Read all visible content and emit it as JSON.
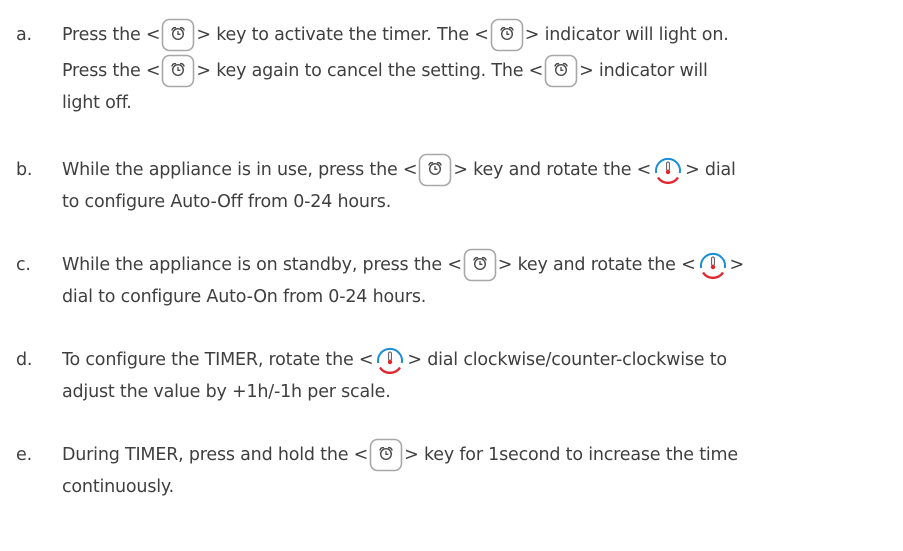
{
  "items": [
    {
      "marker": "a.",
      "t1": "Press the <",
      "icon1": "timer-key-icon",
      "t2": "> key to activate the timer. The <",
      "icon2": "timer-key-icon",
      "t3": "> indicator will light on.",
      "t4": "Press the <",
      "icon3": "timer-key-icon",
      "t5": "> key again to cancel the setting. The <",
      "icon4": "timer-key-icon",
      "t6": "> indicator will",
      "t7": "light off."
    },
    {
      "marker": "b.",
      "t1": "While the appliance is in use, press the <",
      "icon1": "timer-key-icon",
      "t2": "> key and rotate the <",
      "icon2": "temperature-dial-icon",
      "t3": "> dial",
      "t4": "to configure Auto-Off from 0-24 hours."
    },
    {
      "marker": "c.",
      "t1": "While the appliance is on standby, press the <",
      "icon1": "timer-key-icon",
      "t2": "> key and rotate the <",
      "icon2": "temperature-dial-icon",
      "t3": ">",
      "t4": "dial to configure Auto-On from 0-24 hours."
    },
    {
      "marker": "d.",
      "t1": "To configure the TIMER, rotate the <",
      "icon1": "temperature-dial-icon",
      "t2": "> dial clockwise/counter-clockwise to",
      "t3": "adjust the value by +1h/-1h per scale."
    },
    {
      "marker": "e.",
      "t1": "During TIMER, press and hold the <",
      "icon1": "timer-key-icon",
      "t2": "> key for 1second to increase the time",
      "t3": "continuously."
    }
  ],
  "colors": {
    "text": "#3f3f3f",
    "key_outline": "#a8a8a8",
    "dial_blue": "#1b8fd6",
    "dial_red": "#e0262d"
  }
}
